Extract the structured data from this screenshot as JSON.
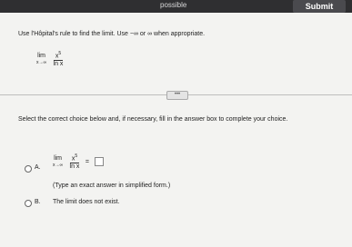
{
  "header": {
    "possible_label": "possible",
    "submit_label": "Submit"
  },
  "question": {
    "text": "Use l'Hôpital's rule to find the limit. Use −∞ or ∞ when appropriate.",
    "lim_word": "lim",
    "lim_sub": "x→∞",
    "numerator": "x",
    "exponent": "5",
    "denominator": "ln x"
  },
  "more_button": "•••",
  "instructions": "Select the correct choice below and, if necessary, fill in the answer box to complete your choice.",
  "options": {
    "a": {
      "letter": "A.",
      "lim_word": "lim",
      "lim_sub": "x→∞",
      "numerator": "x",
      "exponent": "5",
      "denominator": "ln x",
      "equals": "=",
      "answer_value": "",
      "hint": "(Type an exact answer in simplified form.)"
    },
    "b": {
      "letter": "B.",
      "text": "The limit does not exist."
    }
  }
}
